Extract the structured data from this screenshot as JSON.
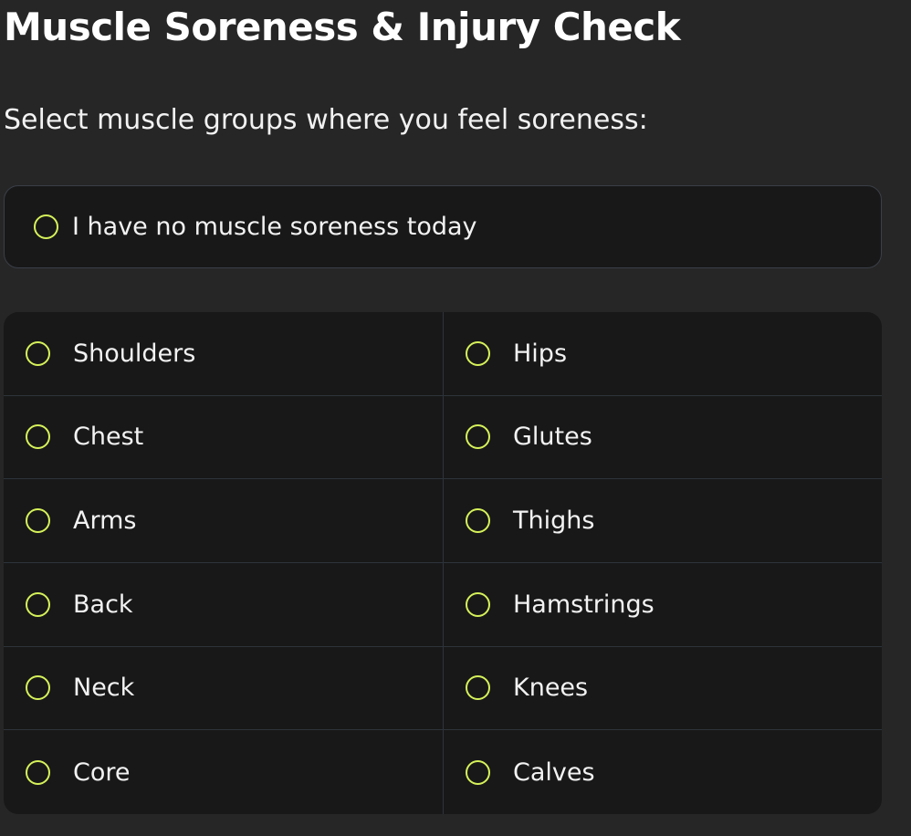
{
  "header": {
    "title": "Muscle Soreness & Injury Check",
    "subtitle": "Select muscle groups where you feel soreness:"
  },
  "none_option": {
    "label": "I have no muscle soreness today",
    "selected": false
  },
  "muscle_groups": [
    {
      "label": "Shoulders",
      "selected": false
    },
    {
      "label": "Hips",
      "selected": false
    },
    {
      "label": "Chest",
      "selected": false
    },
    {
      "label": "Glutes",
      "selected": false
    },
    {
      "label": "Arms",
      "selected": false
    },
    {
      "label": "Thighs",
      "selected": false
    },
    {
      "label": "Back",
      "selected": false
    },
    {
      "label": "Hamstrings",
      "selected": false
    },
    {
      "label": "Neck",
      "selected": false
    },
    {
      "label": "Knees",
      "selected": false
    },
    {
      "label": "Core",
      "selected": false
    },
    {
      "label": "Calves",
      "selected": false
    }
  ],
  "colors": {
    "accent": "#d6f25a",
    "background": "#262626",
    "card": "#181818",
    "border": "#2e333b"
  }
}
